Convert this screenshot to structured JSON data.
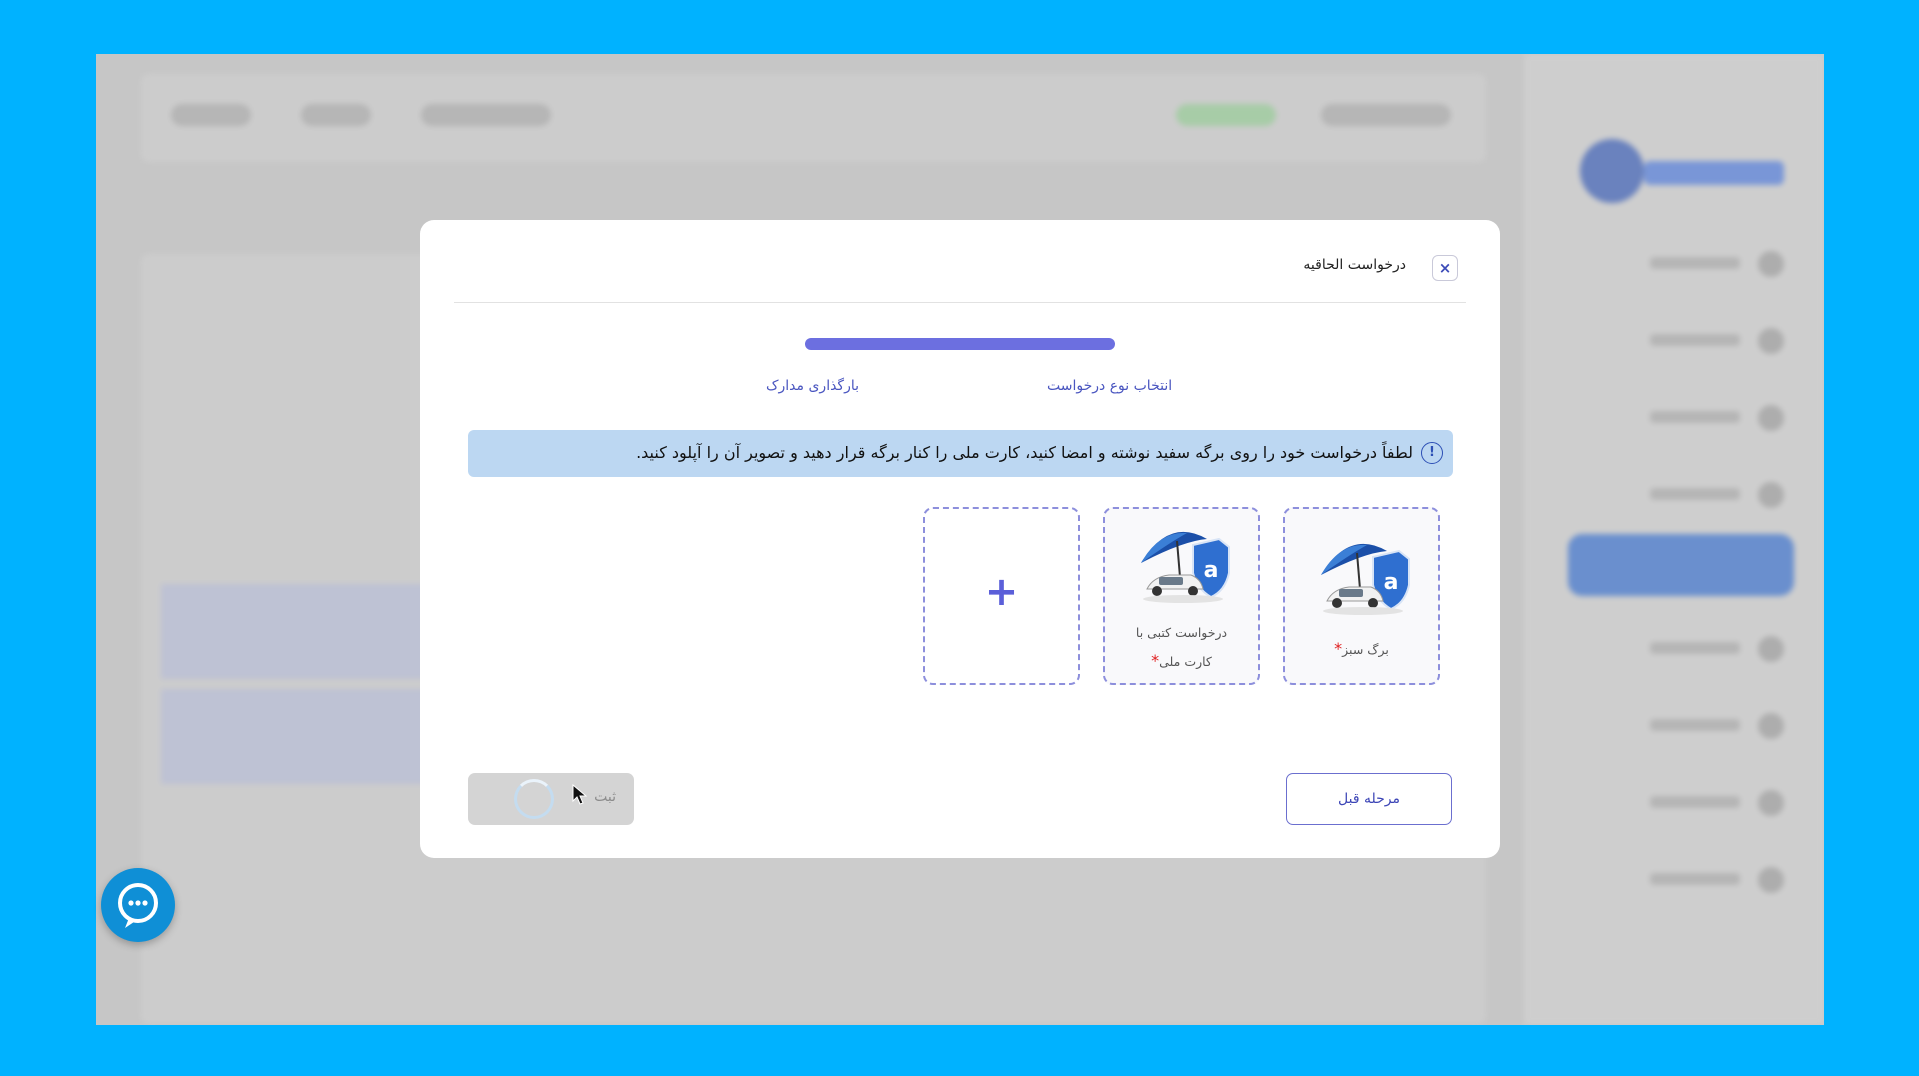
{
  "modal": {
    "title": "درخواست الحاقیه",
    "close_icon": "×",
    "steps": [
      {
        "label": "انتخاب نوع درخواست"
      },
      {
        "label": "بارگذاری مدارک"
      }
    ],
    "alert": {
      "icon": "!",
      "text": "لطفاً درخواست خود را روی برگه سفید نوشته و امضا کنید، کارت ملی را کنار برگه قرار دهید و تصویر آن را آپلود کنید."
    },
    "documents": [
      {
        "caption": "برگ سبز",
        "required_mark": "*"
      },
      {
        "caption_line1": "درخواست کتبی با",
        "caption_line2": "کارت ملی",
        "required_mark": "*"
      }
    ],
    "add_icon": "+",
    "buttons": {
      "previous": "مرحله قبل",
      "submit": "ثبت"
    }
  },
  "colors": {
    "accent": "#6c6fe0",
    "alert_bg": "#bcd7f2",
    "frame": "#00b2ff",
    "chat": "#0f8fd6"
  },
  "icons": [
    "close-icon",
    "info-icon",
    "plus-icon",
    "chat-icon",
    "spinner-icon",
    "cursor-icon"
  ]
}
